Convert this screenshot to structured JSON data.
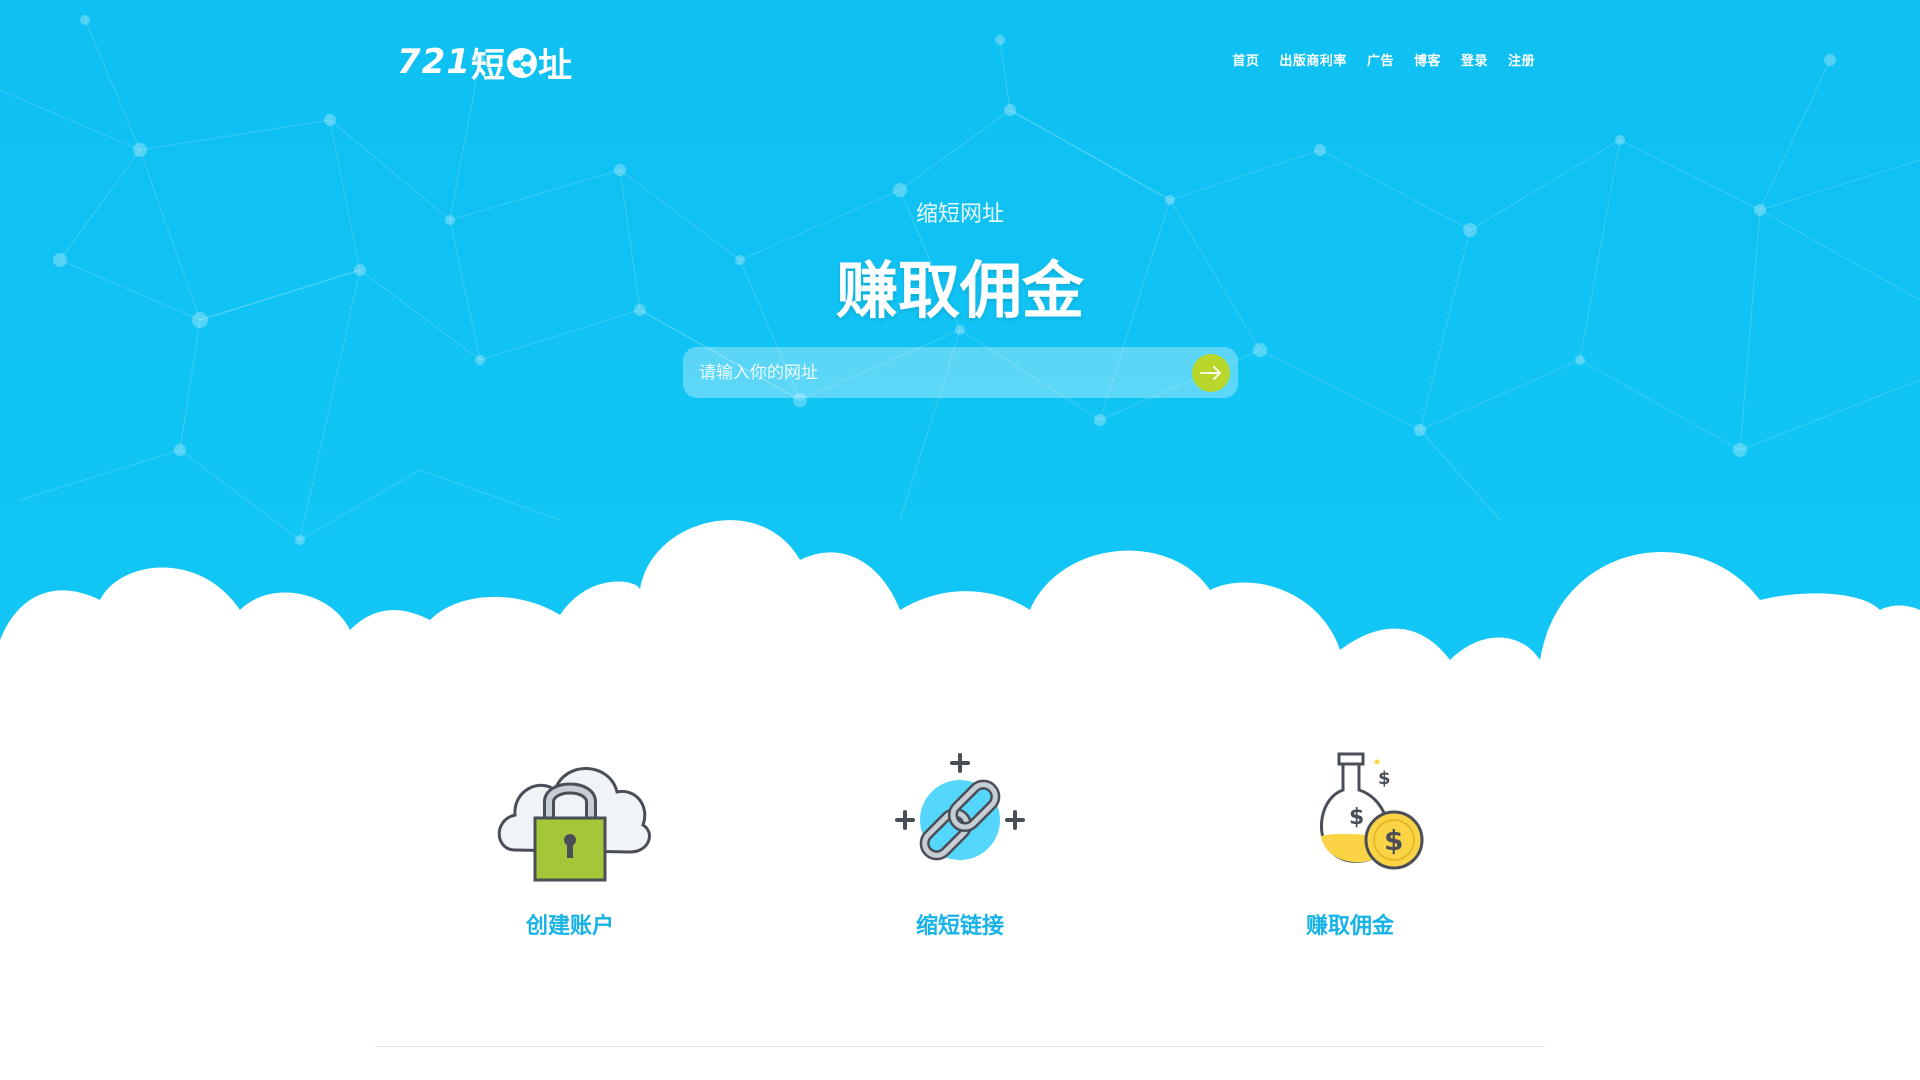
{
  "brand": {
    "logo_number": "721",
    "logo_text_1": "短",
    "logo_text_2": "址"
  },
  "nav": {
    "items": [
      "首页",
      "出版商利率",
      "广告",
      "博客",
      "登录",
      "注册"
    ]
  },
  "hero": {
    "subtitle": "缩短网址",
    "headline": "赚取佣金",
    "search_placeholder": "请输入你的网址"
  },
  "features": [
    {
      "label": "创建账户",
      "icon": "cloud-lock-icon"
    },
    {
      "label": "缩短链接",
      "icon": "chain-link-icon"
    },
    {
      "label": "赚取佣金",
      "icon": "money-flask-icon"
    }
  ],
  "colors": {
    "hero_bg": "#10c4f4",
    "accent": "#18b3e6",
    "submit_button": "#b9d62b",
    "text_light": "#ffffff"
  }
}
